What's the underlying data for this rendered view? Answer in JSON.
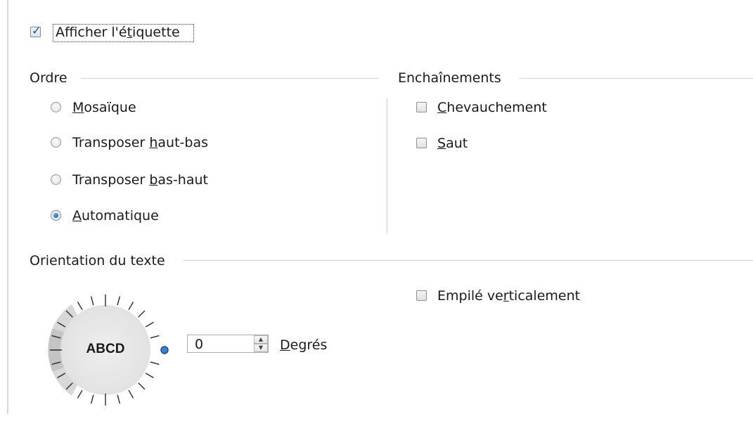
{
  "show_label": {
    "label_pre": "Afficher l'é",
    "label_u": "t",
    "label_post": "iquette",
    "checked": true
  },
  "order": {
    "title": "Ordre",
    "options": [
      {
        "pre": "",
        "u": "M",
        "post": "osaïque",
        "selected": false
      },
      {
        "pre": "Transposer ",
        "u": "h",
        "post": "aut-bas",
        "selected": false
      },
      {
        "pre": "Transposer ",
        "u": "b",
        "post": "as-haut",
        "selected": false
      },
      {
        "pre": "",
        "u": "A",
        "post": "utomatique",
        "selected": true
      }
    ]
  },
  "chains": {
    "title": "Enchaînements",
    "overlap": {
      "pre": "",
      "u": "C",
      "post": "hevauchement",
      "checked": false
    },
    "break": {
      "pre": "",
      "u": "S",
      "post": "aut",
      "checked": false
    }
  },
  "orientation": {
    "title": "Orientation du texte",
    "dial_text": "ABCD",
    "angle_value": "0",
    "unit": {
      "pre": "",
      "u": "D",
      "post": "egrés"
    },
    "stacked": {
      "pre": "Empilé ve",
      "u": "r",
      "post": "ticalement",
      "checked": false
    }
  }
}
